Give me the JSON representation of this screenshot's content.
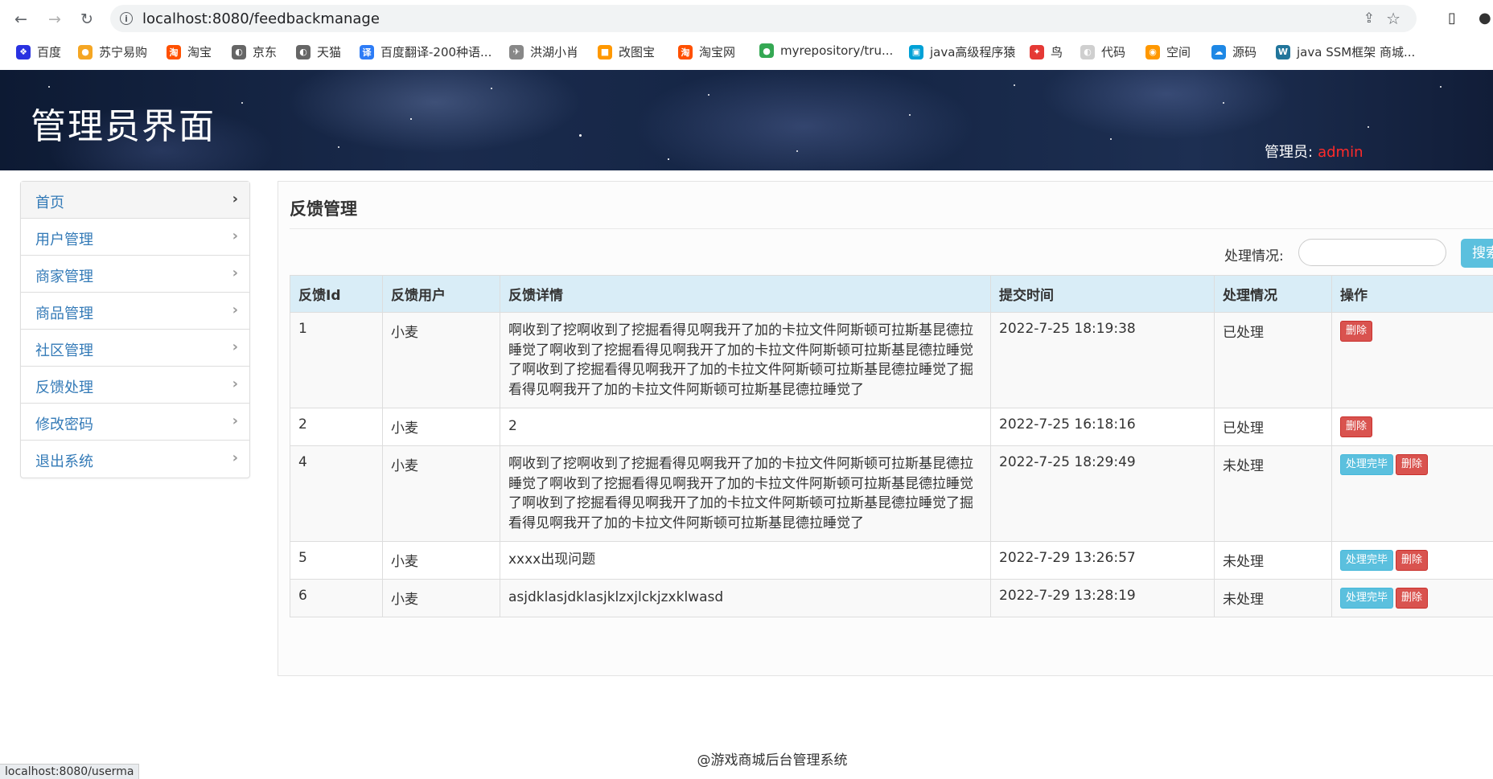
{
  "browser": {
    "url": "localhost:8080/feedbackmanage",
    "bookmarks": [
      {
        "label": "百度",
        "color": "#2932e1",
        "glyph": "❖"
      },
      {
        "label": "苏宁易购",
        "color": "#f5a623",
        "glyph": "●"
      },
      {
        "label": "淘宝",
        "color": "#ff5000",
        "glyph": "淘"
      },
      {
        "label": "京东",
        "color": "#666666",
        "glyph": "◐"
      },
      {
        "label": "天猫",
        "color": "#666666",
        "glyph": "◐"
      },
      {
        "label": "百度翻译-200种语...",
        "color": "#2d7cf6",
        "glyph": "译"
      },
      {
        "label": "洪湖小肖",
        "color": "#888888",
        "glyph": "✈"
      },
      {
        "label": "改图宝",
        "color": "#ff9800",
        "glyph": "■"
      },
      {
        "label": "淘宝网",
        "color": "#ff5000",
        "glyph": "淘"
      },
      {
        "label": "myrepository/tru...",
        "color": "#34a853",
        "glyph": "●"
      },
      {
        "label": "java高级程序猿",
        "color": "#00a1d6",
        "glyph": "▣"
      },
      {
        "label": "鸟",
        "color": "#e53935",
        "glyph": "✦"
      },
      {
        "label": "代码",
        "color": "#cfcfcf",
        "glyph": "◐"
      },
      {
        "label": "空间",
        "color": "#ff9800",
        "glyph": "◉"
      },
      {
        "label": "源码",
        "color": "#1e88e5",
        "glyph": "☁"
      },
      {
        "label": "java SSM框架 商城...",
        "color": "#21759b",
        "glyph": "W"
      }
    ],
    "status_text": "localhost:8080/userma"
  },
  "header": {
    "title": "管理员界面",
    "admin_label": "管理员:",
    "admin_name": "admin"
  },
  "sidebar": {
    "items": [
      {
        "label": "首页"
      },
      {
        "label": "用户管理"
      },
      {
        "label": "商家管理"
      },
      {
        "label": "商品管理"
      },
      {
        "label": "社区管理"
      },
      {
        "label": "反馈处理"
      },
      {
        "label": "修改密码"
      },
      {
        "label": "退出系统"
      }
    ]
  },
  "panel": {
    "title": "反馈管理",
    "filter_label": "处理情况:",
    "filter_value": "",
    "search_label": "搜索"
  },
  "table": {
    "headers": [
      "反馈Id",
      "反馈用户",
      "反馈详情",
      "提交时间",
      "处理情况",
      "操作"
    ],
    "process_label": "处理完毕",
    "delete_label": "删除",
    "rows": [
      {
        "id": "1",
        "user": "小麦",
        "detail": "啊收到了挖啊收到了挖掘看得见啊我开了加的卡拉文件阿斯顿可拉斯基昆德拉睡觉了啊收到了挖掘看得见啊我开了加的卡拉文件阿斯顿可拉斯基昆德拉睡觉了啊收到了挖掘看得见啊我开了加的卡拉文件阿斯顿可拉斯基昆德拉睡觉了掘看得见啊我开了加的卡拉文件阿斯顿可拉斯基昆德拉睡觉了",
        "time": "2022-7-25 18:19:38",
        "status": "已处理",
        "processed": true
      },
      {
        "id": "2",
        "user": "小麦",
        "detail": "2",
        "time": "2022-7-25 16:18:16",
        "status": "已处理",
        "processed": true
      },
      {
        "id": "4",
        "user": "小麦",
        "detail": "啊收到了挖啊收到了挖掘看得见啊我开了加的卡拉文件阿斯顿可拉斯基昆德拉睡觉了啊收到了挖掘看得见啊我开了加的卡拉文件阿斯顿可拉斯基昆德拉睡觉了啊收到了挖掘看得见啊我开了加的卡拉文件阿斯顿可拉斯基昆德拉睡觉了掘看得见啊我开了加的卡拉文件阿斯顿可拉斯基昆德拉睡觉了",
        "time": "2022-7-25 18:29:49",
        "status": "未处理",
        "processed": false
      },
      {
        "id": "5",
        "user": "小麦",
        "detail": "xxxx出现问题",
        "time": "2022-7-29 13:26:57",
        "status": "未处理",
        "processed": false
      },
      {
        "id": "6",
        "user": "小麦",
        "detail": "asjdklasjdklasjklzxjlckjzxklwasd",
        "time": "2022-7-29 13:28:19",
        "status": "未处理",
        "processed": false
      }
    ]
  },
  "footer": {
    "text": "@游戏商城后台管理系统"
  }
}
